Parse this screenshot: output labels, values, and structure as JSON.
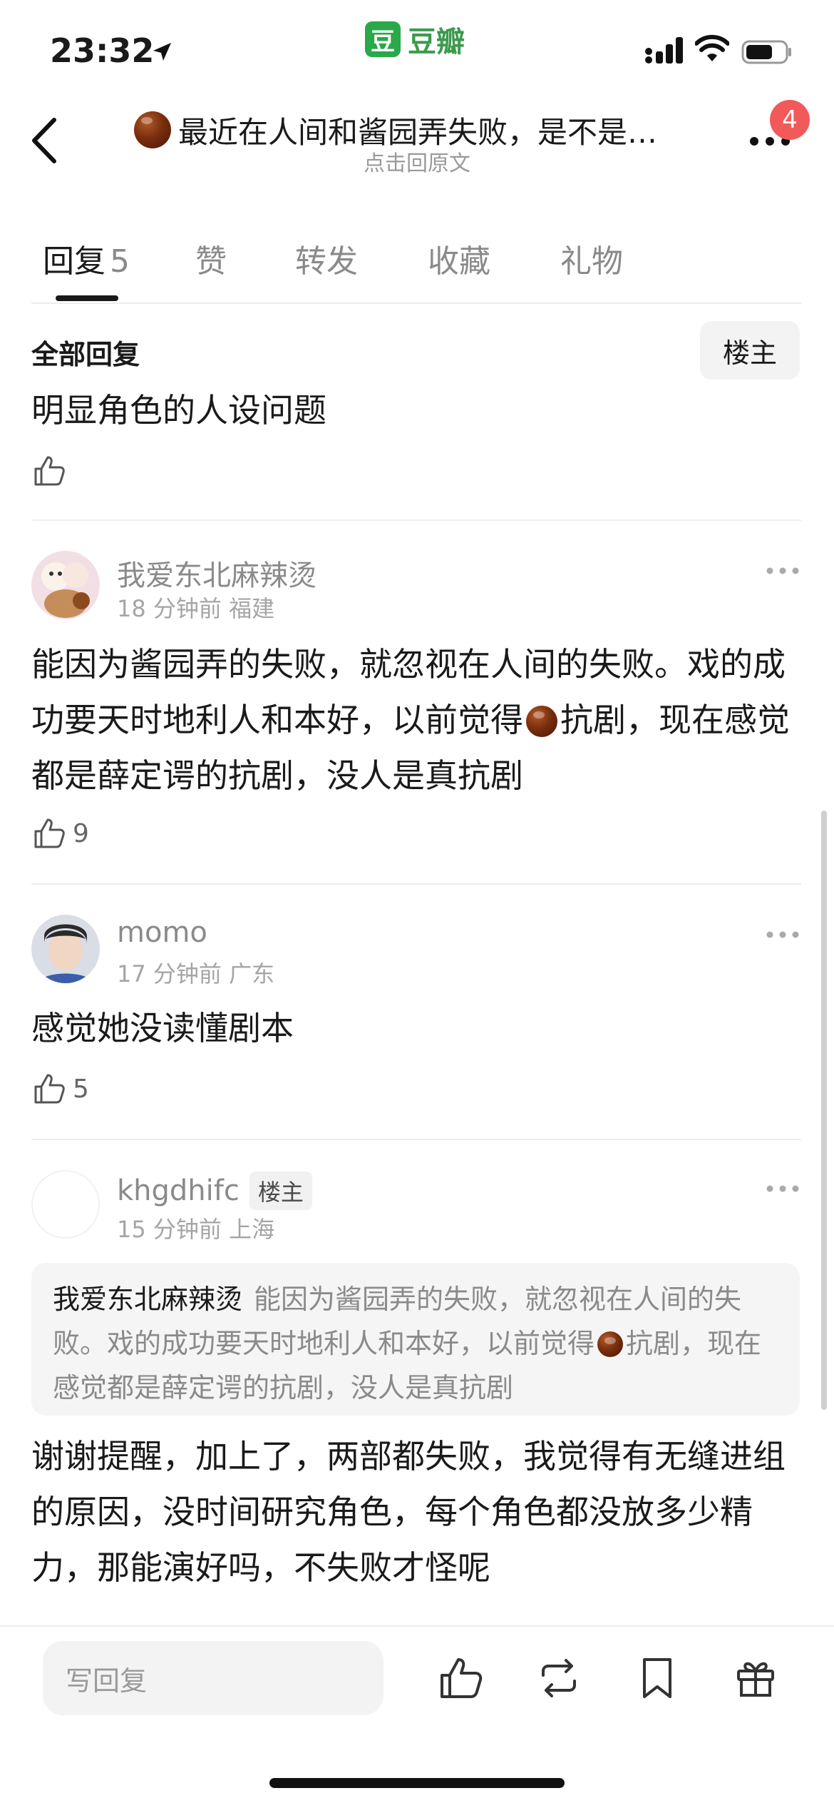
{
  "status_bar": {
    "time": "23:32",
    "app_brand": "豆瓣",
    "app_logo_char": "豆"
  },
  "header": {
    "title": "最近在人间和酱园弄失败，是不是…",
    "subtitle": "点击回原文",
    "notification_count": "4"
  },
  "tabs": [
    {
      "label": "回复",
      "count": "5"
    },
    {
      "label": "赞"
    },
    {
      "label": "转发"
    },
    {
      "label": "收藏"
    },
    {
      "label": "礼物"
    }
  ],
  "section": {
    "title": "全部回复",
    "filter_label": "楼主"
  },
  "replies": [
    {
      "text": "明显角色的人设问题",
      "likes": ""
    },
    {
      "username": "我爱东北麻辣烫",
      "meta": "18 分钟前 福建",
      "text_a": "能因为酱园弄的失败，就忽视在人间的失败。戏的成功要天时地利人和本好，以前觉得",
      "text_b": "抗剧，现在感觉都是薛定谔的抗剧，没人是真抗剧",
      "likes": "9"
    },
    {
      "username": "momo",
      "meta": "17 分钟前 广东",
      "text": "感觉她没读懂剧本",
      "likes": "5"
    },
    {
      "username": "khgdhifc",
      "op_tag": "楼主",
      "meta": "15 分钟前 上海",
      "quote_author": "我爱东北麻辣烫",
      "quote_text_a": "能因为酱园弄的失败，就忽视在人间的失败。戏的成功要天时地利人和本好，以前觉得",
      "quote_text_b": "抗剧，现在感觉都是薛定谔的抗剧，没人是真抗剧",
      "text": "谢谢提醒，加上了，两部都失败，我觉得有无缝进组的原因，没时间研究角色，每个角色都没放多少精力，那能演好吗，不失败才怪呢"
    }
  ],
  "bottom_bar": {
    "reply_placeholder": "写回复"
  },
  "icons": [
    "location-arrow-icon",
    "signal-icon",
    "wifi-icon",
    "battery-icon",
    "back-icon",
    "more-icon",
    "thumbs-up-icon",
    "repost-icon",
    "bookmark-icon",
    "gift-icon",
    "chestnut-emoji-icon"
  ],
  "colors": {
    "brand_green": "#2aa84a",
    "badge_red": "#f25a5a"
  }
}
